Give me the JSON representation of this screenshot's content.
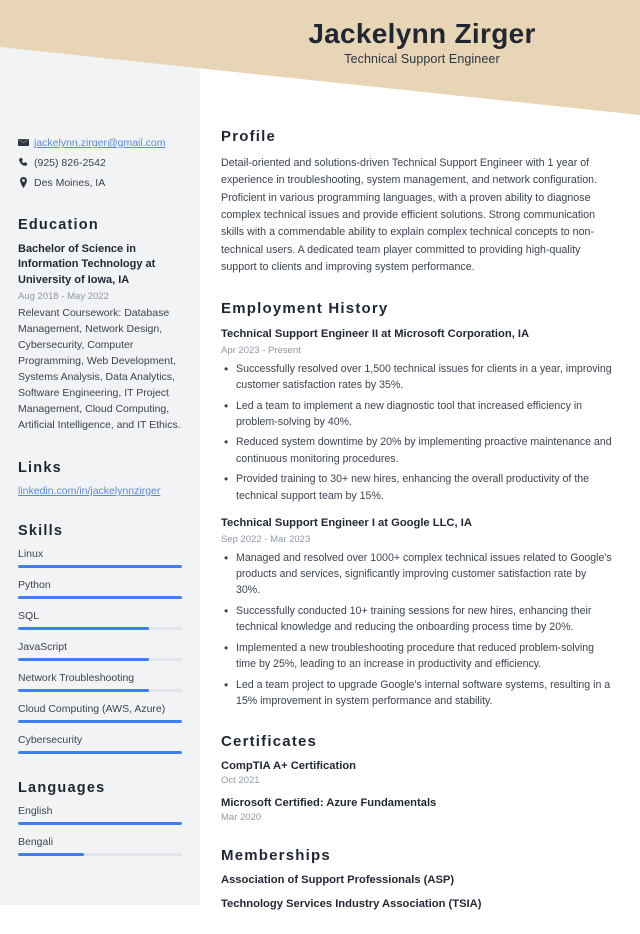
{
  "header": {
    "name": "Jackelynn Zirger",
    "job_title": "Technical Support Engineer",
    "band_color": "#E8D5B5"
  },
  "sidebar": {
    "contact": {
      "email": "jackelynn.zirger@gmail.com",
      "phone": "(925) 826-2542",
      "location": "Des Moines, IA"
    },
    "education": {
      "heading": "Education",
      "degree": "Bachelor of Science in Information Technology at University of Iowa, IA",
      "date": "Aug 2018 - May 2022",
      "coursework": "Relevant Coursework: Database Management, Network Design, Cybersecurity, Computer Programming, Web Development, Systems Analysis, Data Analytics, Software Engineering, IT Project Management, Cloud Computing, Artificial Intelligence, and IT Ethics."
    },
    "links": {
      "heading": "Links",
      "items": [
        {
          "label": "linkedin.com/in/jackelynnzirger"
        }
      ]
    },
    "skills": {
      "heading": "Skills",
      "items": [
        {
          "label": "Linux",
          "level": 100
        },
        {
          "label": "Python",
          "level": 100
        },
        {
          "label": "SQL",
          "level": 80
        },
        {
          "label": "JavaScript",
          "level": 80
        },
        {
          "label": "Network Troubleshooting",
          "level": 80
        },
        {
          "label": "Cloud Computing (AWS, Azure)",
          "level": 100
        },
        {
          "label": "Cybersecurity",
          "level": 100
        }
      ]
    },
    "languages": {
      "heading": "Languages",
      "items": [
        {
          "label": "English",
          "level": 100
        },
        {
          "label": "Bengali",
          "level": 40
        }
      ]
    },
    "accent_color": "#3B7EF7",
    "link_color": "#5B87E8"
  },
  "main": {
    "profile": {
      "heading": "Profile",
      "text": "Detail-oriented and solutions-driven Technical Support Engineer with 1 year of experience in troubleshooting, system management, and network configuration. Proficient in various programming languages, with a proven ability to diagnose complex technical issues and provide efficient solutions. Strong communication skills with a commendable ability to explain complex technical concepts to non-technical users. A dedicated team player committed to providing high-quality support to clients and improving system performance."
    },
    "employment": {
      "heading": "Employment History",
      "jobs": [
        {
          "role": "Technical Support Engineer II at Microsoft Corporation, IA",
          "date": "Apr 2023 - Present",
          "bullets": [
            "Successfully resolved over 1,500 technical issues for clients in a year, improving customer satisfaction rates by 35%.",
            "Led a team to implement a new diagnostic tool that increased efficiency in problem-solving by 40%.",
            "Reduced system downtime by 20% by implementing proactive maintenance and continuous monitoring procedures.",
            "Provided training to 30+ new hires, enhancing the overall productivity of the technical support team by 15%."
          ]
        },
        {
          "role": "Technical Support Engineer I at Google LLC, IA",
          "date": "Sep 2022 - Mar 2023",
          "bullets": [
            "Managed and resolved over 1000+ complex technical issues related to Google's products and services, significantly improving customer satisfaction rate by 30%.",
            "Successfully conducted 10+ training sessions for new hires, enhancing their technical knowledge and reducing the onboarding process time by 20%.",
            "Implemented a new troubleshooting procedure that reduced problem-solving time by 25%, leading to an increase in productivity and efficiency.",
            "Led a team project to upgrade Google's internal software systems, resulting in a 15% improvement in system performance and stability."
          ]
        }
      ]
    },
    "certificates": {
      "heading": "Certificates",
      "items": [
        {
          "name": "CompTIA A+ Certification",
          "date": "Oct 2021"
        },
        {
          "name": "Microsoft Certified: Azure Fundamentals",
          "date": "Mar 2020"
        }
      ]
    },
    "memberships": {
      "heading": "Memberships",
      "items": [
        {
          "name": "Association of Support Professionals (ASP)"
        },
        {
          "name": "Technology Services Industry Association (TSIA)"
        }
      ]
    }
  }
}
